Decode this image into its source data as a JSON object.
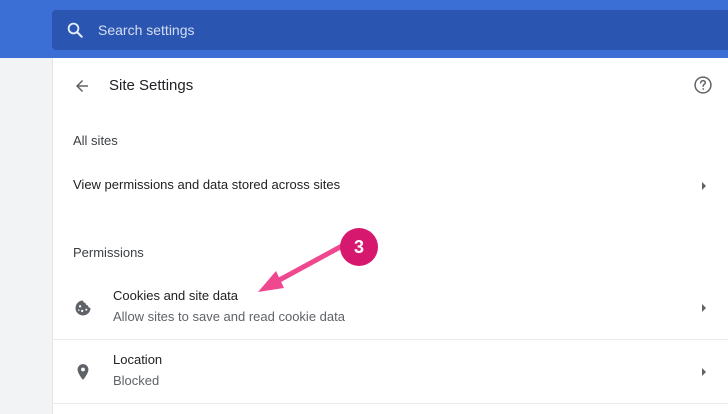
{
  "search": {
    "placeholder": "Search settings",
    "icon": "search-icon"
  },
  "page": {
    "title": "Site Settings"
  },
  "sections": {
    "all_sites": {
      "heading": "All sites",
      "item_label": "View permissions and data stored across sites"
    },
    "permissions": {
      "heading": "Permissions",
      "items": [
        {
          "primary": "Cookies and site data",
          "secondary": "Allow sites to save and read cookie data",
          "icon": "cookie-icon"
        },
        {
          "primary": "Location",
          "secondary": "Blocked",
          "icon": "location-pin-icon"
        }
      ]
    }
  },
  "annotation": {
    "step": "3",
    "color": "#d6196e"
  },
  "colors": {
    "accent": "#3b6fd6",
    "search_bg": "#2a56b2"
  }
}
